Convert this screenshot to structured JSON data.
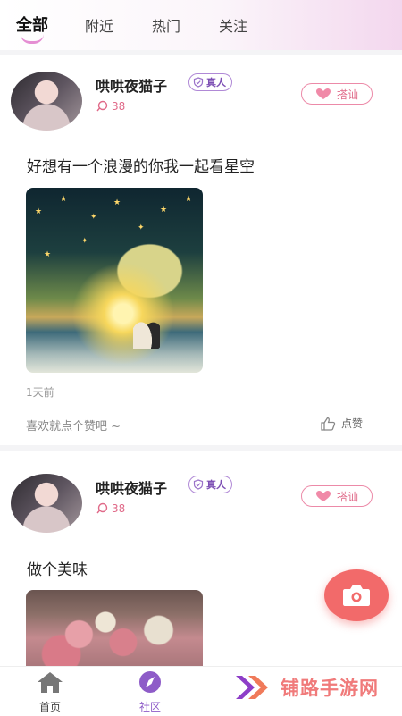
{
  "tabs": [
    {
      "label": "全部",
      "active": true
    },
    {
      "label": "附近",
      "active": false
    },
    {
      "label": "热门",
      "active": false
    },
    {
      "label": "关注",
      "active": false
    }
  ],
  "posts": [
    {
      "username": "哄哄夜猫子",
      "badge": "真人",
      "likes_count": "38",
      "chat_label": "搭讪",
      "text": "好想有一个浪漫的你我一起看星空",
      "time": "1天前",
      "like_hint": "喜欢就点个赞吧 ~",
      "like_label": "点赞"
    },
    {
      "username": "哄哄夜猫子",
      "badge": "真人",
      "likes_count": "38",
      "chat_label": "搭讪",
      "text": "做个美味"
    }
  ],
  "bottom_nav": [
    {
      "label": "首页",
      "icon": "home-icon",
      "active": false
    },
    {
      "label": "社区",
      "icon": "compass-icon",
      "active": true
    }
  ],
  "watermark": {
    "text": "铺路手游网",
    "icon": "double-chevron-logo"
  },
  "colors": {
    "accent_purple": "#8e5cc8",
    "accent_pink": "#e06a89",
    "fab_red": "#f26a6a"
  }
}
